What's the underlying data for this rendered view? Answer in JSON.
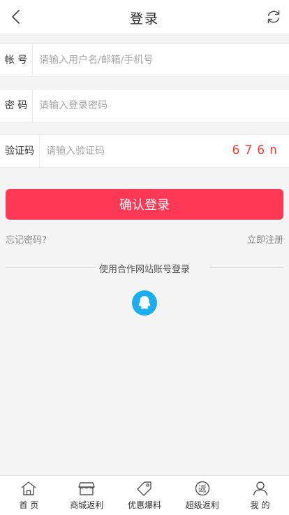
{
  "header": {
    "title": "登录",
    "back_icon": "chevron-left-icon",
    "refresh_icon": "refresh-icon"
  },
  "form": {
    "account": {
      "label": "帐 号",
      "placeholder": "请输入用户名/邮箱/手机号",
      "value": ""
    },
    "password": {
      "label": "密 码",
      "placeholder": "请输入登录密码",
      "value": ""
    },
    "captcha": {
      "label": "验证码",
      "placeholder": "请输入验证码",
      "value": "",
      "code": "676n"
    },
    "submit_label": "确认登录",
    "forgot_label": "忘记密码？",
    "register_label": "立即注册"
  },
  "social": {
    "divider_text": "使用合作网站账号登录",
    "providers": [
      {
        "icon": "qq-icon",
        "color": "#1aaef0"
      }
    ]
  },
  "colors": {
    "accent": "#ff3855",
    "captcha": "#ff3b3b",
    "qq": "#1aaef0"
  },
  "tabs": [
    {
      "label": "首 页",
      "icon": "home-icon"
    },
    {
      "label": "商城返利",
      "icon": "store-icon"
    },
    {
      "label": "优惠爆料",
      "icon": "tag-icon"
    },
    {
      "label": "超级返利",
      "icon": "rebate-icon"
    },
    {
      "label": "我 的",
      "icon": "user-icon"
    }
  ]
}
